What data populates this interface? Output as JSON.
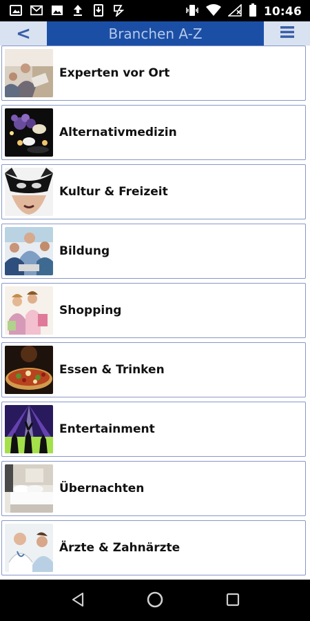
{
  "status_bar": {
    "time": "10:46",
    "left_icons": [
      "gallery-icon",
      "gmail-icon",
      "image-icon",
      "upload-icon",
      "download-icon",
      "check-icon"
    ],
    "right_icons": [
      "vibrate-icon",
      "wifi-icon",
      "signal-icon",
      "battery-icon"
    ]
  },
  "header": {
    "back_label": "<",
    "title": "Branchen A-Z",
    "menu_icon": "hamburger-menu-icon"
  },
  "items": [
    {
      "label": "Experten vor Ort",
      "icon": "experts-photo"
    },
    {
      "label": "Alternativmedizin",
      "icon": "alternative-medicine-photo"
    },
    {
      "label": "Kultur & Freizeit",
      "icon": "mask-photo"
    },
    {
      "label": "Bildung",
      "icon": "education-photo"
    },
    {
      "label": "Shopping",
      "icon": "shopping-photo"
    },
    {
      "label": "Essen & Trinken",
      "icon": "pizza-photo"
    },
    {
      "label": "Entertainment",
      "icon": "concert-photo"
    },
    {
      "label": "Übernachten",
      "icon": "bed-photo"
    },
    {
      "label": "Ärzte & Zahnärzte",
      "icon": "doctor-photo"
    }
  ],
  "nav_bar": {
    "buttons": [
      "back-triangle-icon",
      "home-circle-icon",
      "recents-square-icon"
    ]
  },
  "colors": {
    "header_bg": "#d8e2f1",
    "title_bg": "#1b4fa6",
    "title_text": "#b7c8e8",
    "item_border": "#8896c8"
  }
}
